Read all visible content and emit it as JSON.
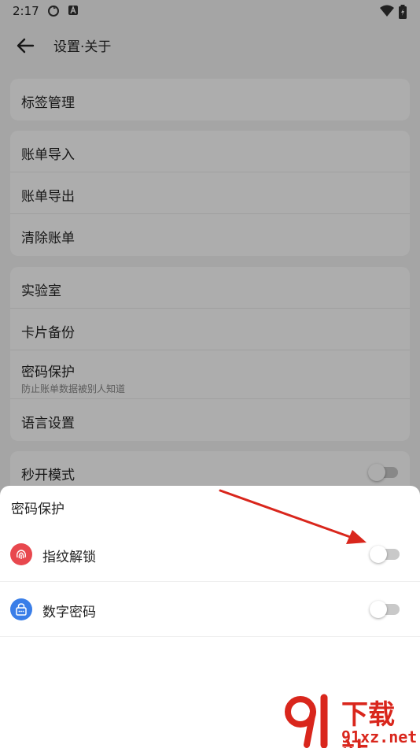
{
  "status_bar": {
    "time": "2:17"
  },
  "app_bar": {
    "title": "设置·关于"
  },
  "groups": [
    {
      "items": [
        {
          "label": "标签管理"
        }
      ]
    },
    {
      "items": [
        {
          "label": "账单导入"
        },
        {
          "label": "账单导出"
        },
        {
          "label": "清除账单"
        }
      ]
    },
    {
      "items": [
        {
          "label": "实验室"
        },
        {
          "label": "卡片备份"
        },
        {
          "label": "密码保护",
          "sub": "防止账单数据被别人知道"
        },
        {
          "label": "语言设置"
        }
      ]
    },
    {
      "items": [
        {
          "label": "秒开模式",
          "toggle": false
        }
      ]
    }
  ],
  "sheet": {
    "title": "密码保护",
    "options": [
      {
        "label": "指纹解锁",
        "icon": "fingerprint-icon",
        "icon_color": "#e8484e",
        "enabled": false
      },
      {
        "label": "数字密码",
        "icon": "lock-keypad-icon",
        "icon_color": "#3a7ee8",
        "enabled": false
      }
    ]
  },
  "annotation": {
    "color": "#d9261c"
  },
  "watermark": {
    "logo_text": "下载站",
    "url": "91xz.net"
  }
}
